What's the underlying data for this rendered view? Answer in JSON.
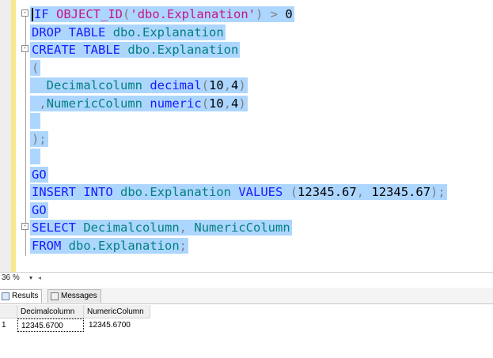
{
  "editor": {
    "lines": [
      [
        {
          "t": "IF",
          "c": "kw"
        },
        {
          "t": " "
        },
        {
          "t": "OBJECT_ID",
          "c": "str"
        },
        {
          "t": "(",
          "c": "gry"
        },
        {
          "t": "'dbo.Explanation'",
          "c": "str"
        },
        {
          "t": ")",
          "c": "gry"
        },
        {
          "t": " "
        },
        {
          "t": ">",
          "c": "gry"
        },
        {
          "t": " 0",
          "c": "num"
        }
      ],
      [
        {
          "t": "DROP",
          "c": "kw"
        },
        {
          "t": " "
        },
        {
          "t": "TABLE",
          "c": "kw"
        },
        {
          "t": " "
        },
        {
          "t": "dbo.Explanation",
          "c": "obj"
        }
      ],
      [
        {
          "t": "CREATE",
          "c": "kw"
        },
        {
          "t": " "
        },
        {
          "t": "TABLE",
          "c": "kw"
        },
        {
          "t": " "
        },
        {
          "t": "dbo.Explanation",
          "c": "obj"
        }
      ],
      [
        {
          "t": "(",
          "c": "gry"
        }
      ],
      [
        {
          "t": "  "
        },
        {
          "t": "Decimalcolumn",
          "c": "obj"
        },
        {
          "t": " "
        },
        {
          "t": "decimal",
          "c": "kw"
        },
        {
          "t": "(",
          "c": "gry"
        },
        {
          "t": "10",
          "c": "num"
        },
        {
          "t": ",",
          "c": "gry"
        },
        {
          "t": "4",
          "c": "num"
        },
        {
          "t": ")",
          "c": "gry"
        }
      ],
      [
        {
          "t": " "
        },
        {
          "t": ",",
          "c": "gry"
        },
        {
          "t": "NumericColumn",
          "c": "obj"
        },
        {
          "t": " "
        },
        {
          "t": "numeric",
          "c": "kw"
        },
        {
          "t": "(",
          "c": "gry"
        },
        {
          "t": "10",
          "c": "num"
        },
        {
          "t": ",",
          "c": "gry"
        },
        {
          "t": "4",
          "c": "num"
        },
        {
          "t": ")",
          "c": "gry"
        }
      ],
      [
        {
          "t": " "
        }
      ],
      [
        {
          "t": ");",
          "c": "gry"
        }
      ],
      [
        {
          "t": " "
        }
      ],
      [
        {
          "t": "GO",
          "c": "kw"
        }
      ],
      [
        {
          "t": "INSERT",
          "c": "kw"
        },
        {
          "t": " "
        },
        {
          "t": "INTO",
          "c": "kw"
        },
        {
          "t": " "
        },
        {
          "t": "dbo.Explanation",
          "c": "obj"
        },
        {
          "t": " "
        },
        {
          "t": "VALUES",
          "c": "kw"
        },
        {
          "t": " "
        },
        {
          "t": "(",
          "c": "gry"
        },
        {
          "t": "12345.67",
          "c": "num"
        },
        {
          "t": ",",
          "c": "gry"
        },
        {
          "t": " "
        },
        {
          "t": "12345.67",
          "c": "num"
        },
        {
          "t": ");",
          "c": "gry"
        }
      ],
      [
        {
          "t": "GO",
          "c": "kw"
        }
      ],
      [
        {
          "t": "SELECT",
          "c": "kw"
        },
        {
          "t": " "
        },
        {
          "t": "Decimalcolumn",
          "c": "obj"
        },
        {
          "t": ",",
          "c": "gry"
        },
        {
          "t": " "
        },
        {
          "t": "NumericColumn",
          "c": "obj"
        }
      ],
      [
        {
          "t": "FROM",
          "c": "kw"
        },
        {
          "t": " "
        },
        {
          "t": "dbo.Explanation",
          "c": "obj"
        },
        {
          "t": ";",
          "c": "gry"
        }
      ]
    ],
    "fold_markers": [
      "-",
      "-",
      "-"
    ]
  },
  "statusbar": {
    "zoom": "36 %",
    "zoom_arrow": "▾",
    "scroll_left": "◂"
  },
  "results_tabs": {
    "results_label": "Results",
    "messages_label": "Messages"
  },
  "grid": {
    "columns": [
      "Decimalcolumn",
      "NumericColumn"
    ],
    "rows": [
      {
        "rownum": "1",
        "cells": [
          "12345.6700",
          "12345.6700"
        ]
      }
    ]
  }
}
